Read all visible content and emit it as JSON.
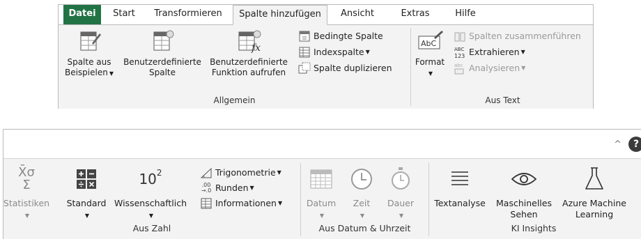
{
  "top": {
    "tabs": [
      "Datei",
      "Start",
      "Transformieren",
      "Spalte hinzufügen",
      "Ansicht",
      "Extras",
      "Hilfe"
    ],
    "active_tab": "Spalte hinzufügen",
    "buttons": {
      "spalte_aus_beispielen": [
        "Spalte aus",
        "Beispielen"
      ],
      "benutzerdefinierte_spalte": [
        "Benutzerdefinierte",
        "Spalte"
      ],
      "benutzerdefinierte_funktion": [
        "Benutzerdefinierte",
        "Funktion aufrufen"
      ],
      "bedingte_spalte": "Bedingte Spalte",
      "indexspalte": "Indexspalte",
      "spalte_duplizieren": "Spalte duplizieren",
      "format": "Format",
      "spalten_zusammenfuehren": "Spalten zusammenführen",
      "extrahieren": "Extrahieren",
      "analysieren": "Analysieren"
    },
    "groups": {
      "allgemein": "Allgemein",
      "aus_text": "Aus Text"
    }
  },
  "bottom": {
    "collapse_icon": "^",
    "help_icon": "?",
    "buttons": {
      "statistiken": "Statistiken",
      "standard": "Standard",
      "wissenschaftlich": "Wissenschaftlich",
      "trigonometrie": "Trigonometrie",
      "runden": "Runden",
      "informationen": "Informationen",
      "datum": "Datum",
      "zeit": "Zeit",
      "dauer": "Dauer",
      "textanalyse": "Textanalyse",
      "maschinelles_sehen": [
        "Maschinelles",
        "Sehen"
      ],
      "azure_ml": [
        "Azure Machine",
        "Learning"
      ]
    },
    "icon_text": {
      "sigma_top": "X̄σ",
      "sigma_bottom": "Σ",
      "power_base": "10",
      "power_exp": "2",
      "round_top": ".00",
      "round_bottom": "→.0"
    },
    "groups": {
      "aus_zahl": "Aus Zahl",
      "aus_datum": "Aus Datum & Uhrzeit",
      "ki_insights": "KI Insights"
    }
  },
  "colors": {
    "file_tab": "#217346",
    "panel_bg": "#f3f3f3",
    "border": "#b9b9b9"
  }
}
